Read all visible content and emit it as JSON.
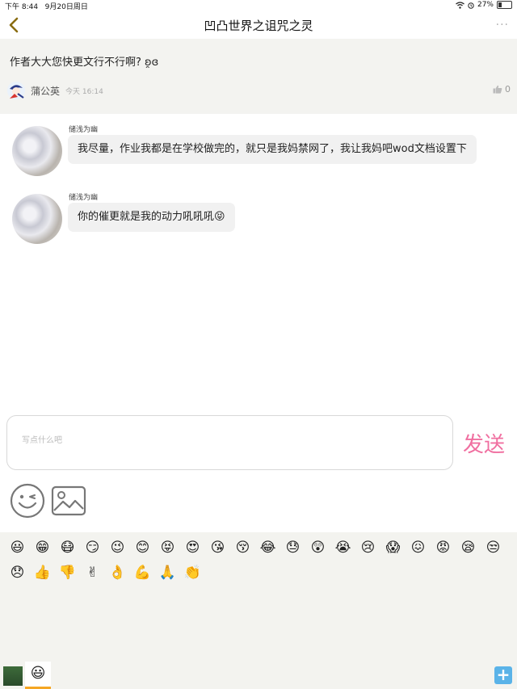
{
  "status_bar": {
    "time": "下午 8:44",
    "date": "9月20日周日",
    "battery": "27%",
    "battery_level": 0.27
  },
  "nav": {
    "title": "凹凸世界之诅咒之灵",
    "more": "···"
  },
  "post": {
    "text": "作者大大您快更文行不行啊? ʚ̯ɞ",
    "author": "蒲公英",
    "time": "今天 16:14",
    "likes": "0"
  },
  "messages": [
    {
      "name": "储浅为幽",
      "text": "我尽量，作业我都是在学校做完的，就只是我妈禁网了，我让我妈吧wod文档设置下"
    },
    {
      "name": "储浅为幽",
      "text": "你的催更就是我的动力吼吼吼😝"
    }
  ],
  "composer": {
    "placeholder": "写点什么吧",
    "value": "",
    "send_label": "发送"
  },
  "emojis": [
    "😃",
    "😁",
    "😷",
    "😏",
    "😉",
    "😊",
    "😝",
    "😍",
    "😘",
    "😚",
    "😂",
    "😓",
    "😲",
    "😭",
    "😢",
    "😱",
    "😖",
    "😡",
    "😪",
    "😒",
    "😞",
    "👍",
    "👎",
    "✌",
    "👌",
    "💪",
    "🙏",
    "👏"
  ],
  "tabs": {
    "emoji_tab_icon": "😃"
  },
  "colors": {
    "send": "#f06fa0",
    "accent": "#f5a623",
    "add": "#5ab3e8",
    "back_arrow": "#8a6d12"
  }
}
